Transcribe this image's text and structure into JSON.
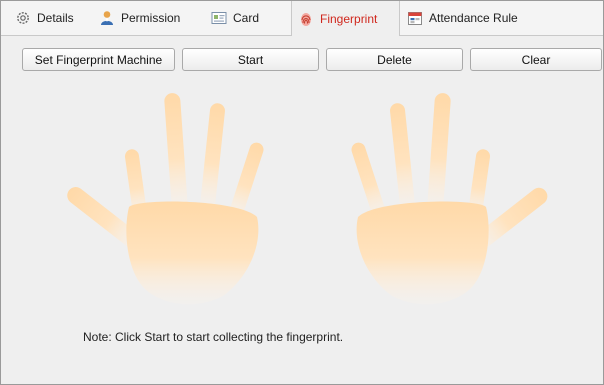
{
  "tabs": [
    {
      "label": "Details",
      "icon": "gear-icon",
      "active": false
    },
    {
      "label": "Permission",
      "icon": "user-icon",
      "active": false
    },
    {
      "label": "Card",
      "icon": "card-icon",
      "active": false
    },
    {
      "label": "Fingerprint",
      "icon": "fingerprint-icon",
      "active": true
    },
    {
      "label": "Attendance Rule",
      "icon": "calendar-icon",
      "active": false
    }
  ],
  "toolbar": {
    "set_machine_label": "Set Fingerprint Machine",
    "start_label": "Start",
    "delete_label": "Delete",
    "clear_label": "Clear"
  },
  "note": "Note: Click Start to start collecting the fingerprint.",
  "colors": {
    "active_tab_text": "#d0271d",
    "hand_fill": "#ffdcae"
  }
}
